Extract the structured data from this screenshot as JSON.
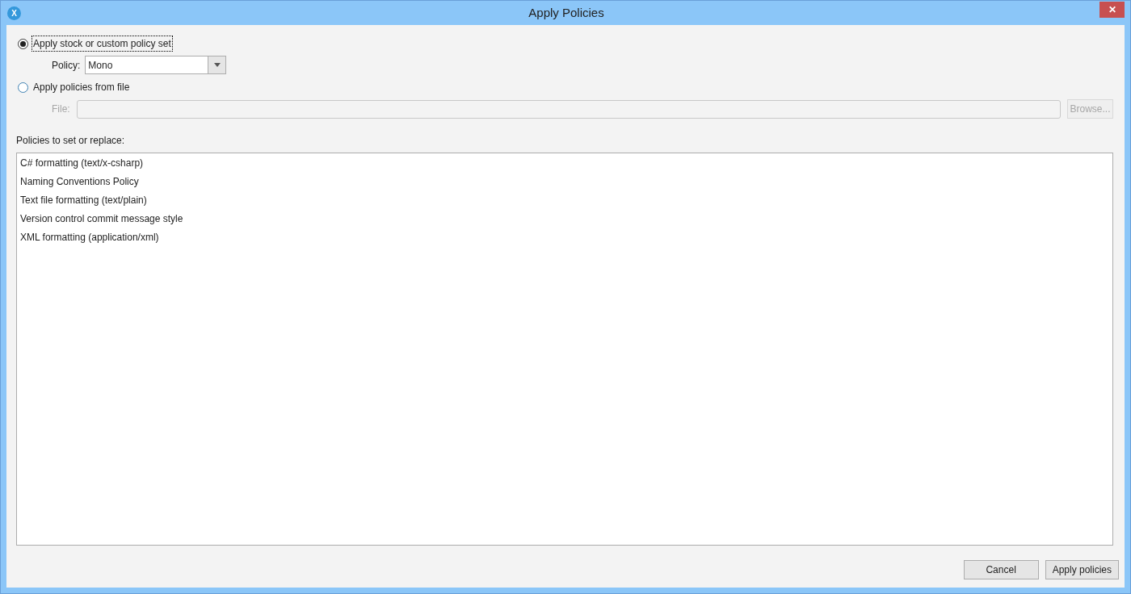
{
  "window": {
    "title": "Apply Policies",
    "close_glyph": "✕",
    "app_glyph": "X"
  },
  "options": [
    {
      "label": "Apply stock or custom policy set",
      "selected": true,
      "focused": true
    },
    {
      "label": "Apply policies from file",
      "selected": false,
      "focused": false
    }
  ],
  "policy": {
    "label": "Policy:",
    "value": "Mono"
  },
  "file": {
    "label": "File:",
    "disabled": true,
    "browse": "Browse..."
  },
  "list": {
    "label": "Policies to set or replace:",
    "items": [
      "C# formatting (text/x-csharp)",
      "Naming Conventions Policy",
      "Text file formatting (text/plain)",
      "Version control commit message style",
      "XML formatting (application/xml)"
    ]
  },
  "buttons": [
    "Cancel",
    "Apply policies"
  ]
}
